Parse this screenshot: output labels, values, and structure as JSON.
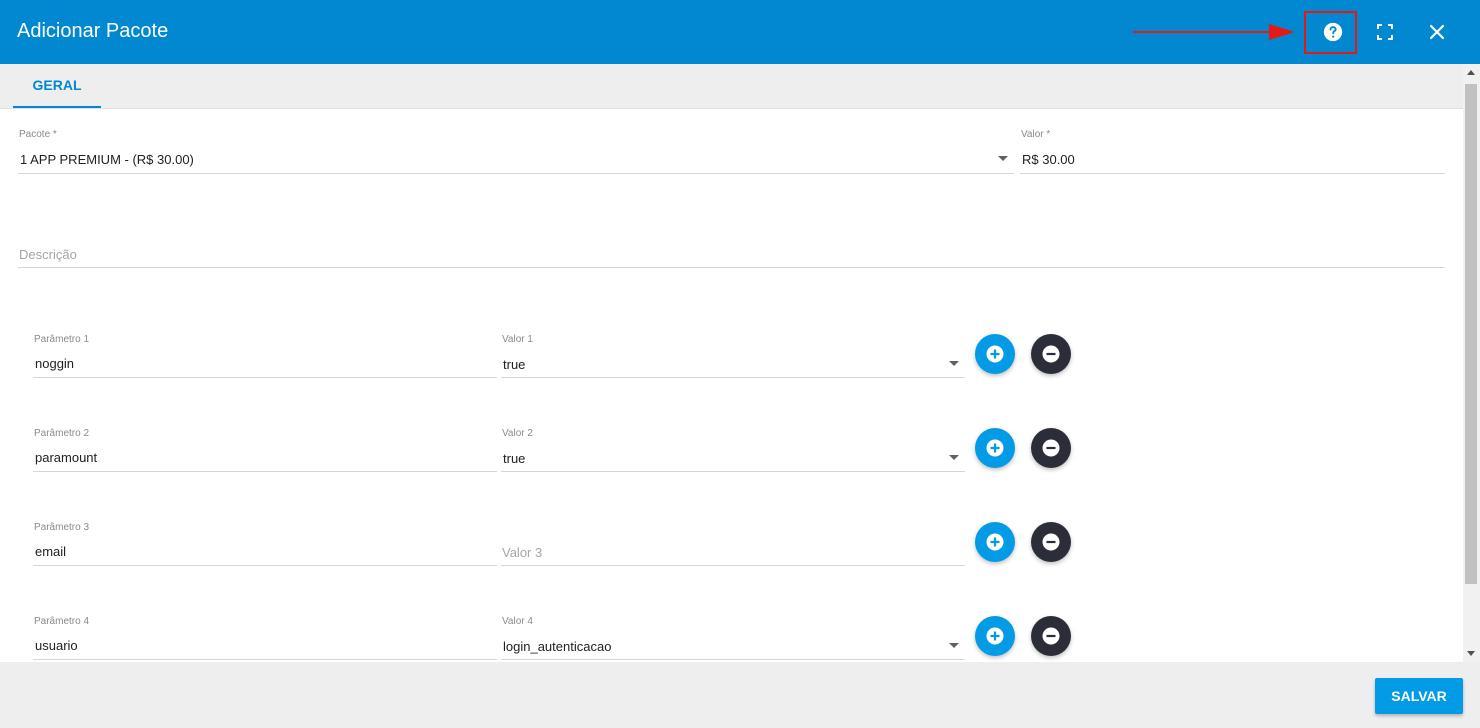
{
  "dialog": {
    "title": "Adicionar Pacote"
  },
  "header_icons": {
    "help": "help-circle-icon",
    "fullscreen": "fullscreen-icon",
    "close": "close-icon"
  },
  "tabs": [
    {
      "label": "GERAL",
      "active": true
    }
  ],
  "form": {
    "pacote": {
      "label": "Pacote *",
      "value": "1 APP PREMIUM - (R$ 30.00)"
    },
    "valor": {
      "label": "Valor *",
      "value": "R$ 30.00"
    },
    "descricao": {
      "placeholder": "Descrição",
      "value": ""
    },
    "params": [
      {
        "label": "Parâmetro 1",
        "value": "noggin",
        "value_label": "Valor 1",
        "value_value": "true"
      },
      {
        "label": "Parâmetro 2",
        "value": "paramount",
        "value_label": "Valor 2",
        "value_value": "true"
      },
      {
        "label": "Parâmetro 3",
        "value": "email",
        "value_placeholder": "Valor 3",
        "value_value": ""
      },
      {
        "label": "Parâmetro 4",
        "value": "usuario",
        "value_label": "Valor 4",
        "value_value": "login_autenticacao"
      }
    ]
  },
  "footer": {
    "save_label": "SALVAR"
  },
  "colors": {
    "primary": "#0288d1",
    "accent": "#039be5",
    "remove": "#2b2e38",
    "annotation": "#e41a1a"
  }
}
